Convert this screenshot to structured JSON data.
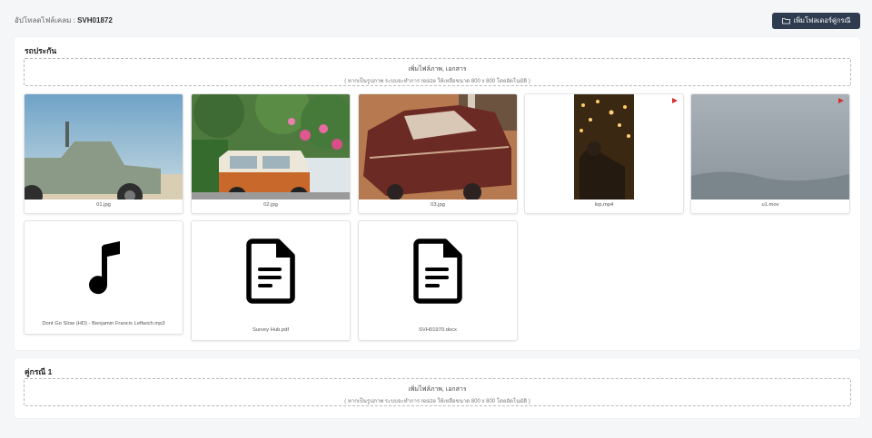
{
  "header": {
    "title_label": "อัปโหลดไฟล์เคลม :",
    "claim_no": "SVH01872",
    "add_folder_label": "เพิ่มโฟลเดอร์คู่กรณี"
  },
  "dropzone": {
    "main": "เพิ่มไฟล์ภาพ, เอกสาร",
    "hint": "( หากเป็นรูปภาพ ระบบจะทำการ resize ให้เหลือขนาด 800 x 800 โดยอัตโนมัติ )"
  },
  "sections": [
    {
      "title": "รถประกัน",
      "files": [
        {
          "name": "01.jpg",
          "kind": "image"
        },
        {
          "name": "02.jpg",
          "kind": "image"
        },
        {
          "name": "03.jpg",
          "kind": "image"
        },
        {
          "name": "lop.mp4",
          "kind": "video"
        },
        {
          "name": "u1.mov",
          "kind": "video"
        },
        {
          "name": "Dont Go Slow (HD) - Benjamin Francis Leftwich.mp3",
          "kind": "audio",
          "icon": "music-note-icon"
        },
        {
          "name": "Survey Hub.pdf",
          "kind": "document",
          "icon": "document-icon"
        },
        {
          "name": "SVH01970.docx",
          "kind": "document",
          "icon": "document-icon"
        }
      ]
    },
    {
      "title": "คู่กรณี 1",
      "files": []
    }
  ],
  "colors": {
    "primary_button": "#2f3c4f",
    "play_badge": "#d32f2f",
    "page_bg": "#f5f6f8"
  }
}
